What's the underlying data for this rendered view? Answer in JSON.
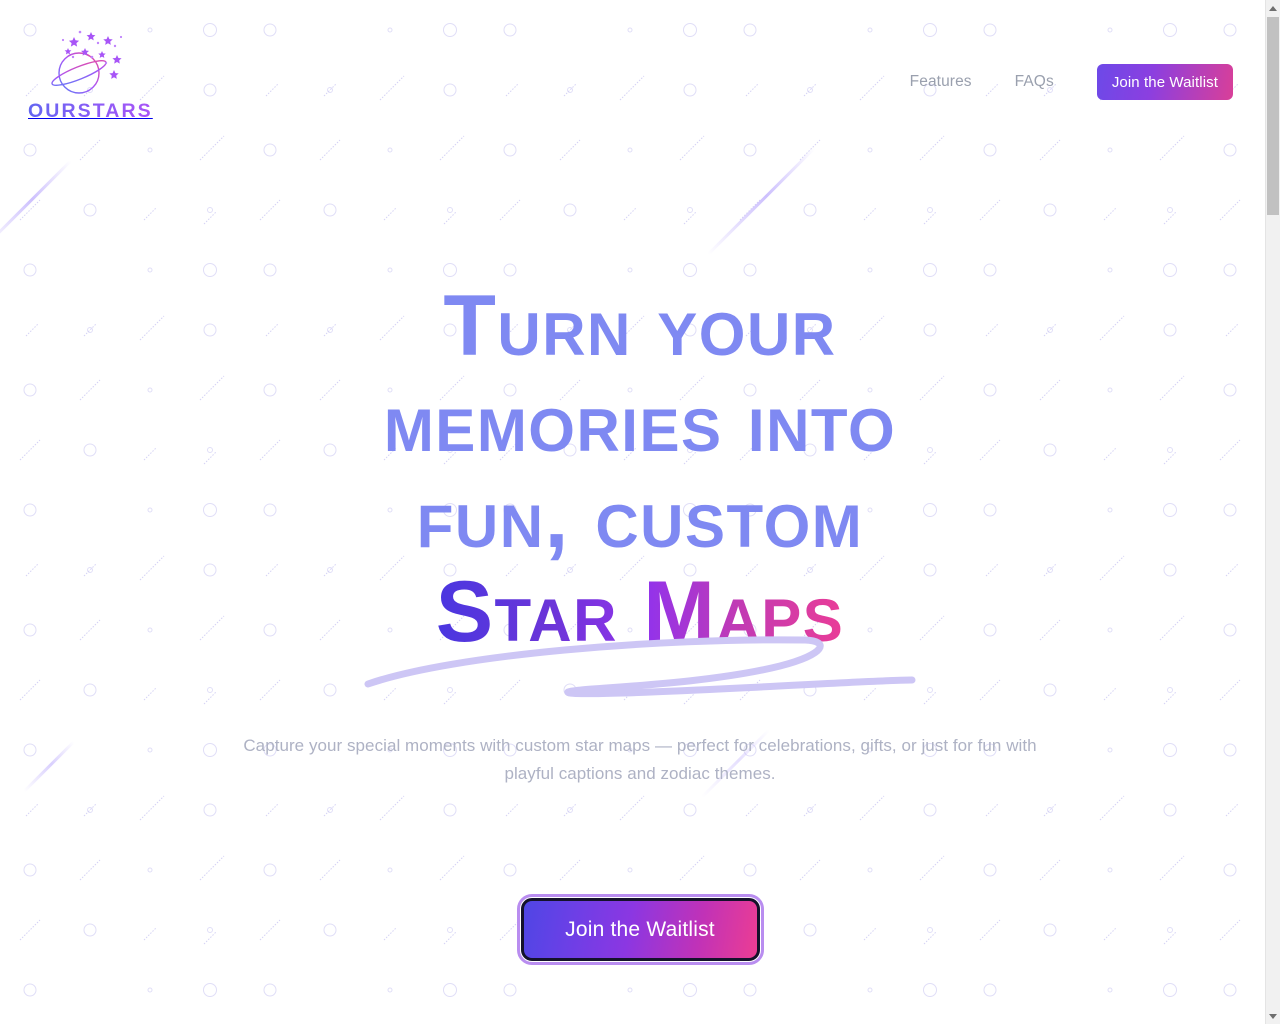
{
  "brand": {
    "name": "OURSTARS",
    "logo_icon": "planet-with-stars-icon"
  },
  "nav": {
    "links": [
      {
        "label": "Features",
        "name": "nav-link-features"
      },
      {
        "label": "FAQs",
        "name": "nav-link-faqs"
      }
    ],
    "cta_label": "Join the Waitlist"
  },
  "hero": {
    "headline_line1": "Turn your",
    "headline_line2": "memories into",
    "headline_line3": "fun, custom",
    "headline_accent": "Star Maps",
    "subtitle": "Capture your special moments with custom star maps — perfect for celebrations, gifts, or just for fun with playful captions and zodiac themes.",
    "cta_label": "Join the Waitlist"
  },
  "colors": {
    "headline": "#7f89f2",
    "accent_gradient_start": "#4a36e0",
    "accent_gradient_end": "#ea3d97",
    "cta_gradient_start": "#4f46e5",
    "cta_gradient_end": "#ec3d93",
    "subtitle": "#aeb2c4",
    "nav_link": "#9aa0ae",
    "underline": "#cdc6f5",
    "background": "#ffffff"
  },
  "scrollbar": {
    "up_arrow": "scroll-up-arrow-icon",
    "down_arrow": "scroll-down-arrow-icon"
  }
}
